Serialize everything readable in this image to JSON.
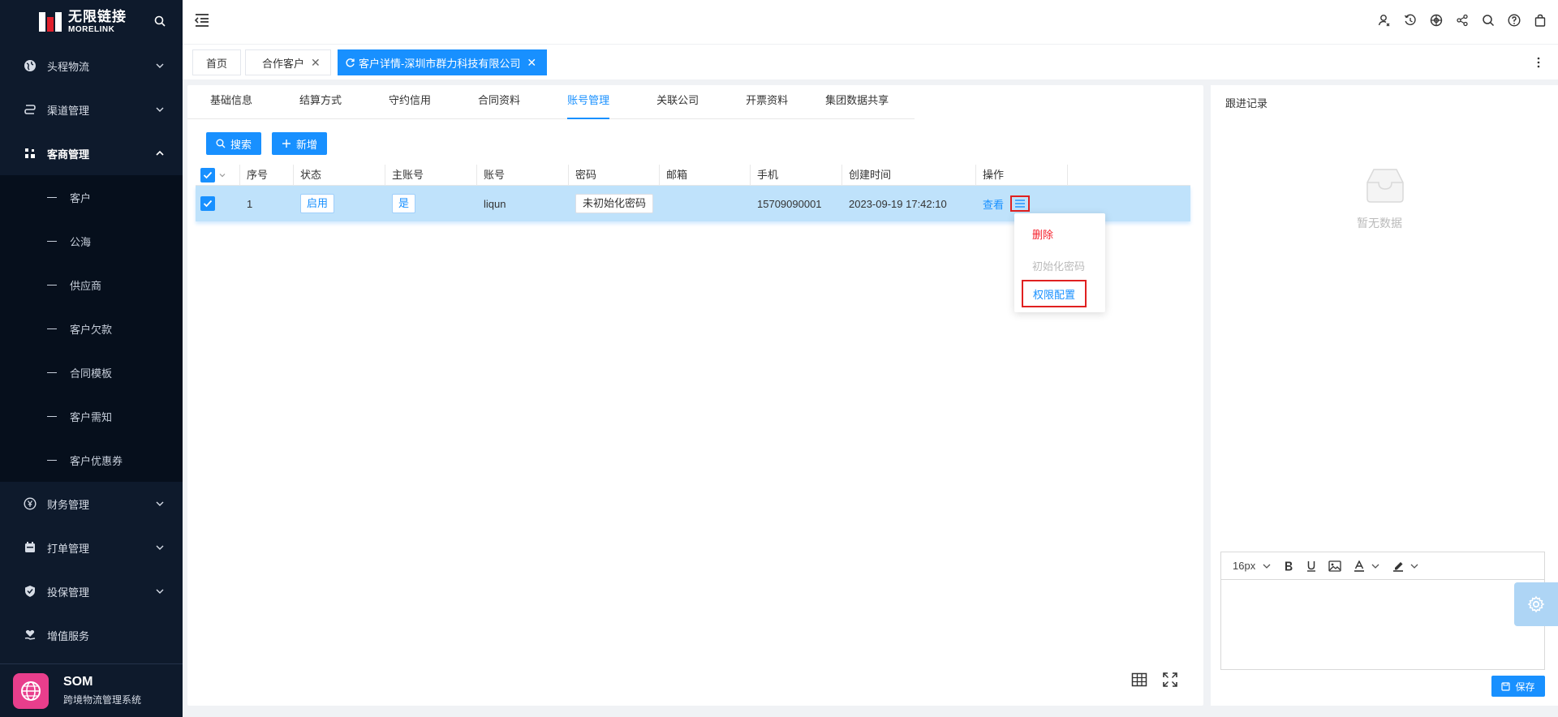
{
  "brand": {
    "name_cn": "无限链接",
    "name_en": "MORELINK"
  },
  "sidebar": {
    "menus": [
      {
        "label": "头程物流"
      },
      {
        "label": "渠道管理"
      },
      {
        "label": "客商管理"
      },
      {
        "label": "财务管理"
      },
      {
        "label": "打单管理"
      },
      {
        "label": "投保管理"
      },
      {
        "label": "增值服务"
      }
    ],
    "sub": [
      {
        "label": "客户"
      },
      {
        "label": "公海"
      },
      {
        "label": "供应商"
      },
      {
        "label": "客户欠款"
      },
      {
        "label": "合同模板"
      },
      {
        "label": "客户需知"
      },
      {
        "label": "客户优惠券"
      }
    ],
    "footer": {
      "title": "SOM",
      "subtitle": "跨境物流管理系统"
    }
  },
  "page_tabs": [
    {
      "label": "首页"
    },
    {
      "label": "合作客户"
    },
    {
      "label": "客户详情-深圳市群力科技有限公司"
    }
  ],
  "sub_tabs": [
    {
      "label": "基础信息"
    },
    {
      "label": "结算方式"
    },
    {
      "label": "守约信用"
    },
    {
      "label": "合同资料"
    },
    {
      "label": "账号管理"
    },
    {
      "label": "关联公司"
    },
    {
      "label": "开票资料"
    },
    {
      "label": "集团数据共享"
    }
  ],
  "toolbar": {
    "search_label": "搜索",
    "add_label": "新增"
  },
  "table": {
    "columns": [
      "序号",
      "状态",
      "主账号",
      "账号",
      "密码",
      "邮箱",
      "手机",
      "创建时间",
      "操作"
    ],
    "row": {
      "index": "1",
      "status": "启用",
      "is_main": "是",
      "account": "liqun",
      "password": "未初始化密码",
      "email": "",
      "phone": "15709090001",
      "created": "2023-09-19 17:42:10",
      "view": "查看"
    }
  },
  "dropdown": {
    "delete": "删除",
    "init_password": "初始化密码",
    "permissions": "权限配置"
  },
  "right_panel": {
    "title": "跟进记录",
    "empty": "暂无数据",
    "font_size": "16px",
    "save": "保存"
  },
  "colors": {
    "primary": "#1890ff",
    "sidebar_bg": "#0e1a2c",
    "danger": "#f5222d",
    "highlight": "#e02020"
  }
}
